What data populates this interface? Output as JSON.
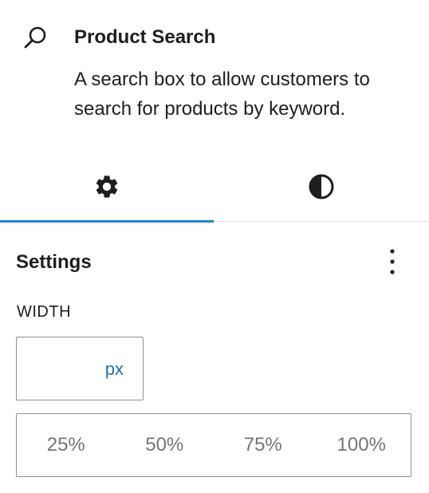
{
  "block": {
    "icon": "search-icon",
    "title": "Product Search",
    "description": "A search box to allow customers to search for products by keyword."
  },
  "tabs": [
    {
      "name": "settings",
      "icon": "gear-icon",
      "active": true
    },
    {
      "name": "styles",
      "icon": "contrast-icon",
      "active": false
    }
  ],
  "colors": {
    "accent": "#1e88c8",
    "unit_text": "#2271b1",
    "muted_text": "#757575",
    "border": "#8c8f94"
  },
  "panel": {
    "title": "Settings",
    "menu_icon": "more-vertical-icon",
    "width_label": "WIDTH",
    "width_value": "",
    "width_unit": "px",
    "percent_options": [
      "25%",
      "50%",
      "75%",
      "100%"
    ]
  }
}
